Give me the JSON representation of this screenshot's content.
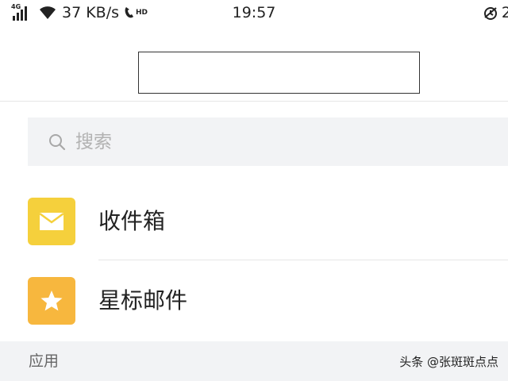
{
  "status_bar": {
    "network_tag": "4G",
    "net_speed": "37 KB/s",
    "volte_badge": "HD",
    "time": "19:57",
    "battery_partial": "2"
  },
  "search": {
    "placeholder": "搜索"
  },
  "mail_items": [
    {
      "label": "收件箱",
      "icon": "envelope-icon",
      "color": "#f5d03c"
    },
    {
      "label": "星标邮件",
      "icon": "star-icon",
      "color": "#f7b73e"
    }
  ],
  "section": {
    "title": "应用"
  },
  "watermark": "头条 @张斑斑点点"
}
